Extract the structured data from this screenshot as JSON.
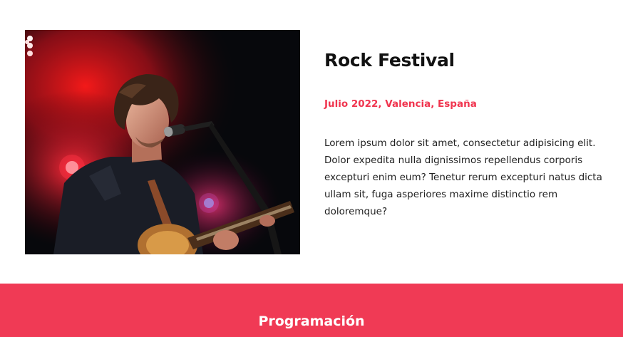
{
  "event": {
    "title": "Rock Festival",
    "subtitle": "Julio 2022, Valencia, España",
    "description": "Lorem ipsum dolor sit amet, consectetur adipisicing elit. Dolor expedita nulla dignissimos repellendus corporis excepturi enim eum? Tenetur rerum excepturi natus dicta ullam sit, fuga asperiores maxime distinctio rem doloremque?",
    "image": "rock-singer-with-guitar-photo"
  },
  "banner": {
    "title": "Programación"
  },
  "colors": {
    "accent": "#f0354f",
    "banner_bg": "#f03a55",
    "title_text": "#111111",
    "body_text": "#222222"
  }
}
